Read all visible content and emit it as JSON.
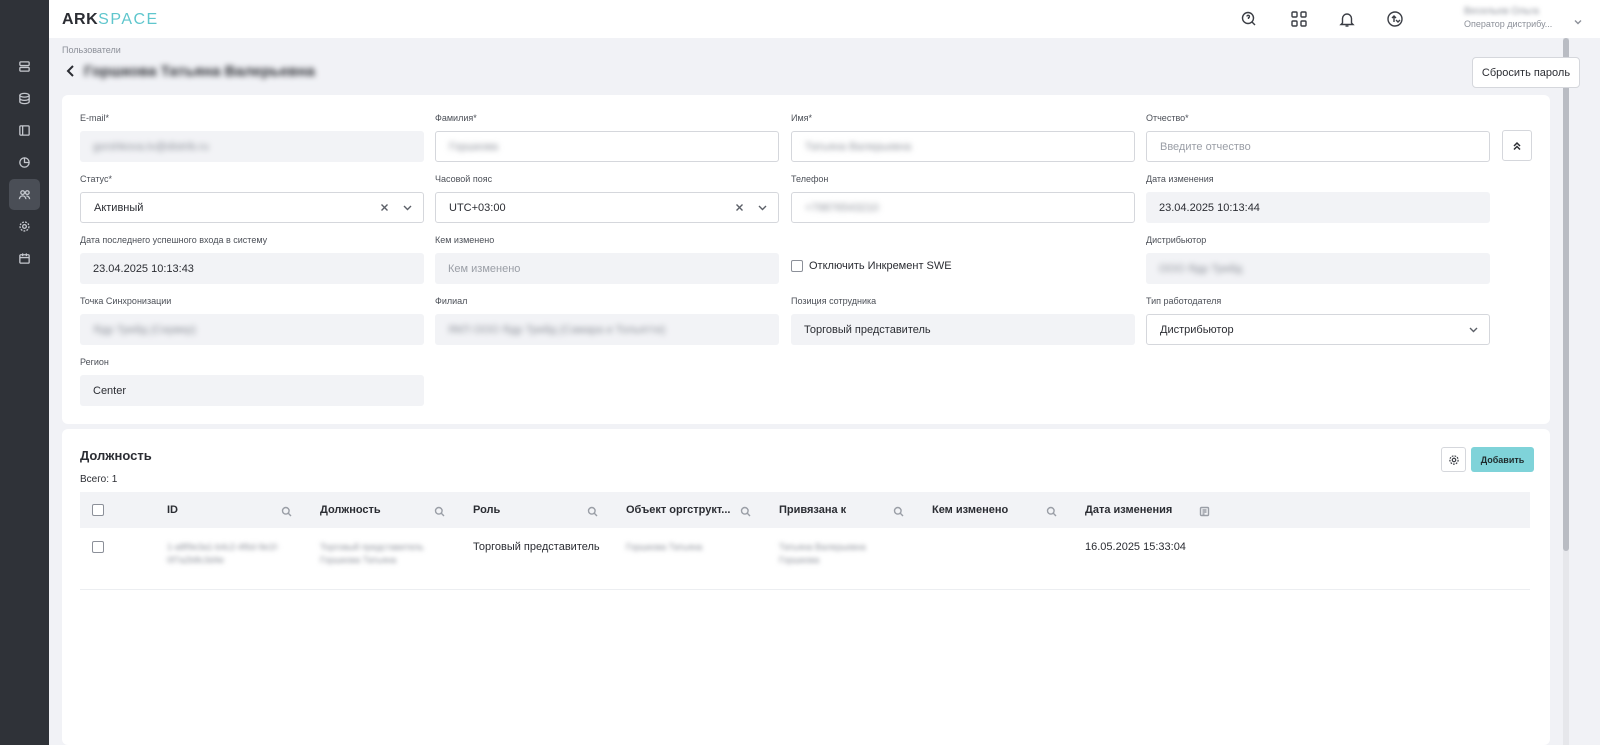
{
  "app": {
    "logo_main": "ARK",
    "logo_accent": "SPACE"
  },
  "header": {
    "user_name": "Весельев Ольга",
    "user_role": "Оператор дистрибу..."
  },
  "breadcrumb": "Пользователи",
  "page": {
    "title": "Горшкова Татьяна Валерьевна",
    "reset_password_label": "Сбросить пароль"
  },
  "form": {
    "email": {
      "label": "E-mail*",
      "value": "gorshkova.tv@distrib.ru"
    },
    "last_name": {
      "label": "Фамилия*",
      "value": "Горшкова"
    },
    "first_name": {
      "label": "Имя*",
      "value": "Татьяна Валерьевна"
    },
    "middle_name": {
      "label": "Отчество*",
      "placeholder": "Введите отчество"
    },
    "status": {
      "label": "Статус*",
      "value": "Активный"
    },
    "timezone": {
      "label": "Часовой пояс",
      "value": "UTC+03:00"
    },
    "phone": {
      "label": "Телефон",
      "value": "+79876543210"
    },
    "modified_date": {
      "label": "Дата изменения",
      "value": "23.04.2025 10:13:44"
    },
    "last_login": {
      "label": "Дата последнего успешного входа в систему",
      "value": "23.04.2025 10:13:43"
    },
    "modified_by": {
      "label": "Кем изменено",
      "placeholder": "Кем изменено"
    },
    "disable_increment": {
      "label": "Отключить Инкремент SWE"
    },
    "distributor": {
      "label": "Дистрибьютор",
      "value": "ООО Ядр Трейд"
    },
    "sync_point": {
      "label": "Точка Синхронизации",
      "value": "Ядр Трейд (Сервер)"
    },
    "branch": {
      "label": "Филиал",
      "value": "ЯКП ООО Ядр Трейд (Самара и Тольятти)"
    },
    "position": {
      "label": "Позиция сотрудника",
      "value": "Торговый представитель"
    },
    "employer_type": {
      "label": "Тип работодателя",
      "value": "Дистрибьютор"
    },
    "region": {
      "label": "Регион",
      "value": "Center"
    }
  },
  "positions": {
    "title": "Должность",
    "total": "Всего: 1",
    "add_label": "Добавить",
    "columns": [
      "ID",
      "Должность",
      "Роль",
      "Объект оргструкт...",
      "Привязана к",
      "Кем изменено",
      "Дата изменения"
    ],
    "rows": [
      {
        "id": "1-a8f9e3a1-b4c2-4f6d-9e1f-0f7a2b8c3d4e",
        "position": "Торговый представитель Горшкова Татьяна",
        "role": "Торговый представитель",
        "org_object": "Горшкова Татьяна",
        "linked_to": "Татьяна Валерьевна Горшкова",
        "modified_by": "",
        "modified_date": "16.05.2025 15:33:04"
      }
    ]
  },
  "colors": {
    "sidebar": "#2f3238",
    "accent": "#7fd3d9",
    "logo_accent": "#5fc6cd"
  }
}
